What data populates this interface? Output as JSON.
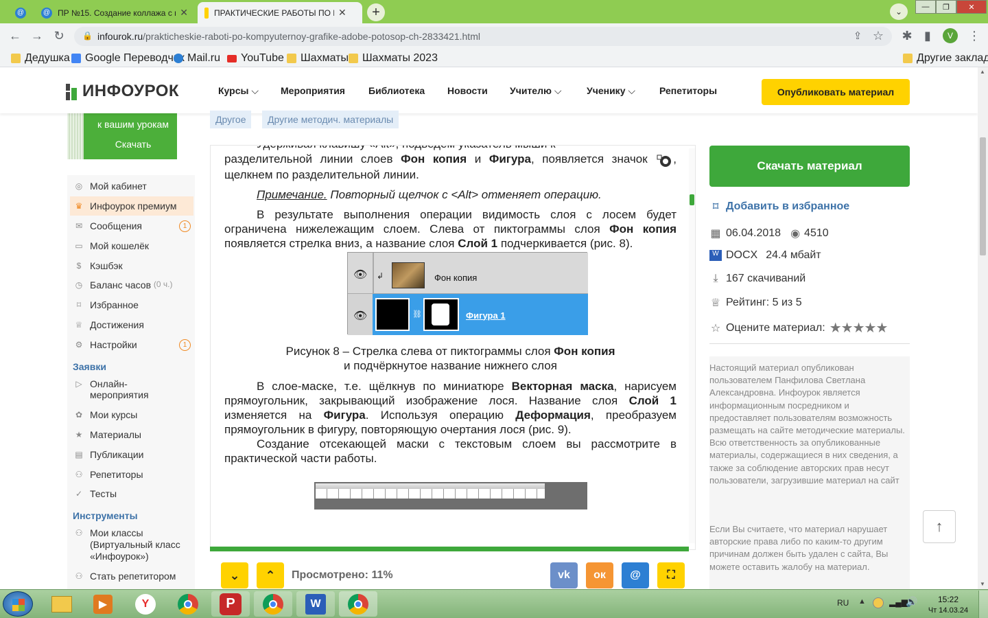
{
  "browser": {
    "tabs": [
      {
        "label": "",
        "icon": "mail-ru-icon"
      },
      {
        "label": "ПР №15. Создание коллажа с п",
        "icon": "mail-ru-icon"
      },
      {
        "label": "ПРАКТИЧЕСКИЕ РАБОТЫ ПО КО",
        "icon": "infourok-icon"
      }
    ],
    "url_host": "infourok.ru",
    "url_path": "/prakticheskie-raboti-po-kompyuternoy-grafike-adobe-potosop-ch-2833421.html",
    "profile_letter": "V",
    "bookmarks": [
      "Дедушка",
      "Google Переводчик",
      "Mail.ru",
      "YouTube",
      "Шахматы",
      "Шахматы 2023"
    ],
    "other_bookmarks": "Другие закладки"
  },
  "site": {
    "logo_text": "ИНФОУРОК",
    "nav": [
      "Курсы",
      "Мероприятия",
      "Библиотека",
      "Новости",
      "Учителю",
      "Ученику",
      "Репетиторы"
    ],
    "publish_label": "Опубликовать материал",
    "promo": {
      "line1": "к вашим урокам",
      "cta": "Скачать"
    },
    "chips": [
      "Другое",
      "Другие методич. материалы"
    ]
  },
  "sidebar": {
    "items": [
      {
        "label": "Мой кабинет",
        "icon": "user-icon"
      },
      {
        "label": "Инфоурок премиум",
        "icon": "crown-icon"
      },
      {
        "label": "Сообщения",
        "icon": "mail-icon",
        "badge": "1"
      },
      {
        "label": "Мой кошелёк",
        "icon": "wallet-icon"
      },
      {
        "label": "Кэшбэк",
        "icon": "cashback-icon"
      },
      {
        "label": "Баланс часов",
        "icon": "clock-icon",
        "extra": "(0 ч.)"
      },
      {
        "label": "Избранное",
        "icon": "bookmark-icon"
      },
      {
        "label": "Достижения",
        "icon": "trophy-icon"
      },
      {
        "label": "Настройки",
        "icon": "gear-icon",
        "badge": "1"
      }
    ],
    "section1": "Заявки",
    "items2": [
      {
        "label": "Онлайн-мероприятия",
        "icon": "video-icon"
      },
      {
        "label": "Мои курсы",
        "icon": "courses-icon"
      },
      {
        "label": "Материалы",
        "icon": "star-icon"
      },
      {
        "label": "Публикации",
        "icon": "publications-icon"
      },
      {
        "label": "Репетиторы",
        "icon": "tutors-icon"
      },
      {
        "label": "Тесты",
        "icon": "check-icon"
      }
    ],
    "section2": "Инструменты",
    "items3": [
      {
        "label": "Мои классы (Виртуальный класс «Инфоурок»)",
        "icon": "classes-icon"
      },
      {
        "label": "Стать репетитором",
        "icon": "tutor-icon"
      }
    ]
  },
  "doc": {
    "para1_top": "Удерживая клавишу «Alt», подведем указатель мыши к",
    "para1_a": "разделительной линии слоев ",
    "para1_b1": "Фон копия",
    "para1_c": " и ",
    "para1_b2": "Фигура",
    "para1_d": ", появляется значок",
    "para1_e": ", щелкнем по разделительной линии.",
    "note_label": "Примечание.",
    "note_text": " Повторный щелчок с <Alt> отменяет операцию.",
    "para2_a": "В результате выполнения операции видимость слоя с лосем будет ограничена нижележащим слоем. Слева от пиктограммы слоя ",
    "para2_b1": "Фон копия",
    "para2_c": " появляется стрелка вниз, а название слоя ",
    "para2_b2": "Слой 1",
    "para2_d": " подчеркивается (рис. 8).",
    "layer1": "Фон копия",
    "layer2": "Фигура 1",
    "caption_a": "Рисунок 8 – Стрелка слева от пиктограммы слоя ",
    "caption_b": "Фон копия",
    "caption_c": "и подчёркнутое название нижнего слоя",
    "para3_a": "В слое-маске, т.е. щёлкнув по миниатюре ",
    "para3_b1": "Векторная маска",
    "para3_c": ", нарисуем прямоугольник, закрывающий изображение лося. Название слоя ",
    "para3_b2": "Слой 1",
    "para3_d": " изменяется на ",
    "para3_b3": "Фигура",
    "para3_e": ". Используя операцию ",
    "para3_b4": "Деформация",
    "para3_f": ", преобразуем прямоугольник в фигуру, повторяющую очертания лося (рис. 9).",
    "para4": "Создание отсекающей маски с текстовым слоем вы рассмотрите в практической части работы.",
    "viewed_label": "Просмотрено: 11%",
    "viewed_progress": 0.11
  },
  "right": {
    "download_label": "Скачать материал",
    "favorite_label": "Добавить в избранное",
    "date": "06.04.2018",
    "views": "4510",
    "format": "DOCX",
    "size": "24.4 мбайт",
    "downloads": "167 скачиваний",
    "rating": "Рейтинг: 5 из 5",
    "rate_label": "Оцените материал:",
    "stars": 5,
    "disclaimer1": "Настоящий материал опубликован пользователем Панфилова Светлана Александровна. Инфоурок является информационным посредником и предоставляет пользователям возможность размещать на сайте методические материалы. Всю ответственность за опубликованные материалы, содержащиеся в них сведения, а также за соблюдение авторских прав несут пользователи, загрузившие материал на сайт",
    "disclaimer2": "Если Вы считаете, что материал нарушает авторские права либо по каким-то другим причинам должен быть удален с сайта, Вы можете оставить жалобу на материал."
  },
  "taskbar": {
    "lang": "RU",
    "time": "15:22",
    "date": "Чт 14.03.24"
  },
  "colors": {
    "brand_green": "#3ea83b",
    "accent_yellow": "#ffd200",
    "tab_green": "#8fcc52"
  }
}
